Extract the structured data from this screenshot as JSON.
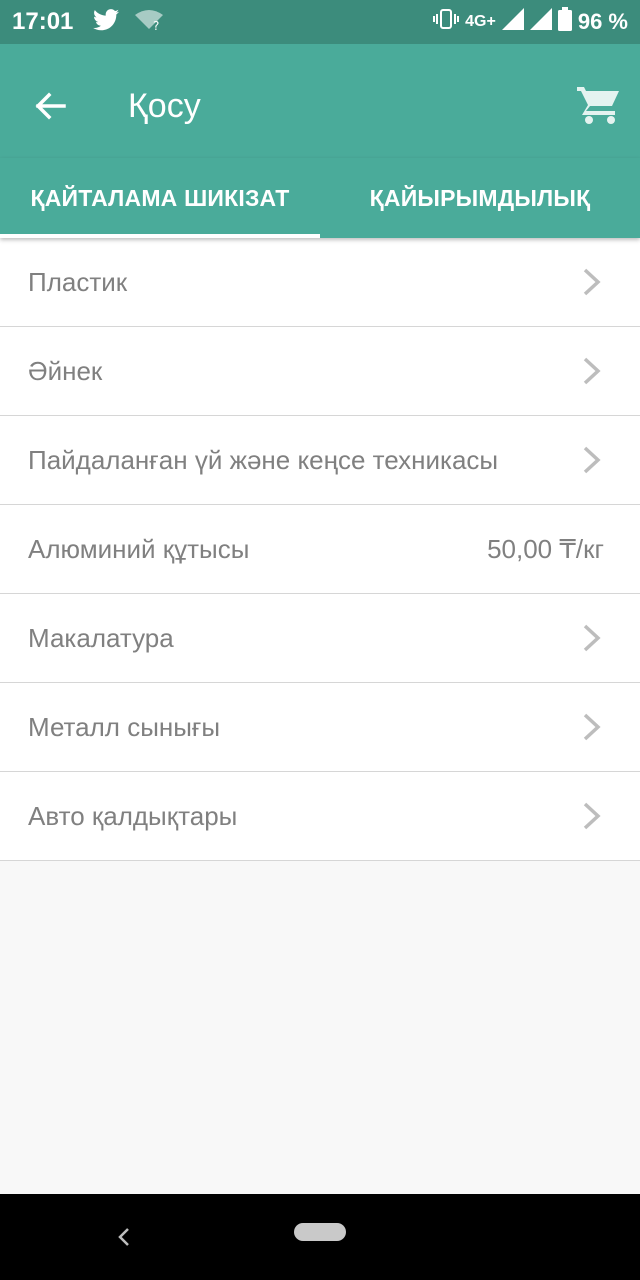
{
  "status_bar": {
    "time": "17:01",
    "network": "4G+",
    "battery": "96 %"
  },
  "app_bar": {
    "title": "Қосу"
  },
  "tabs": [
    {
      "label": "ҚАЙТАЛАМА ШИКІЗАТ",
      "active": true
    },
    {
      "label": "ҚАЙЫРЫМДЫЛЫҚ",
      "active": false
    }
  ],
  "categories": [
    {
      "label": "Пластик",
      "price": ""
    },
    {
      "label": "Әйнек",
      "price": ""
    },
    {
      "label": "Пайдаланған үй және кеңсе техникасы",
      "price": ""
    },
    {
      "label": "Алюминий құтысы",
      "price": "50,00 ₸/кг"
    },
    {
      "label": "Макалатура",
      "price": ""
    },
    {
      "label": "Металл сынығы",
      "price": ""
    },
    {
      "label": "Авто қалдықтары",
      "price": ""
    }
  ],
  "colors": {
    "status_bar": "#3c8c7c",
    "app_bar": "#4aab9a",
    "text_secondary": "#808080",
    "background": "#f8f8f8"
  }
}
